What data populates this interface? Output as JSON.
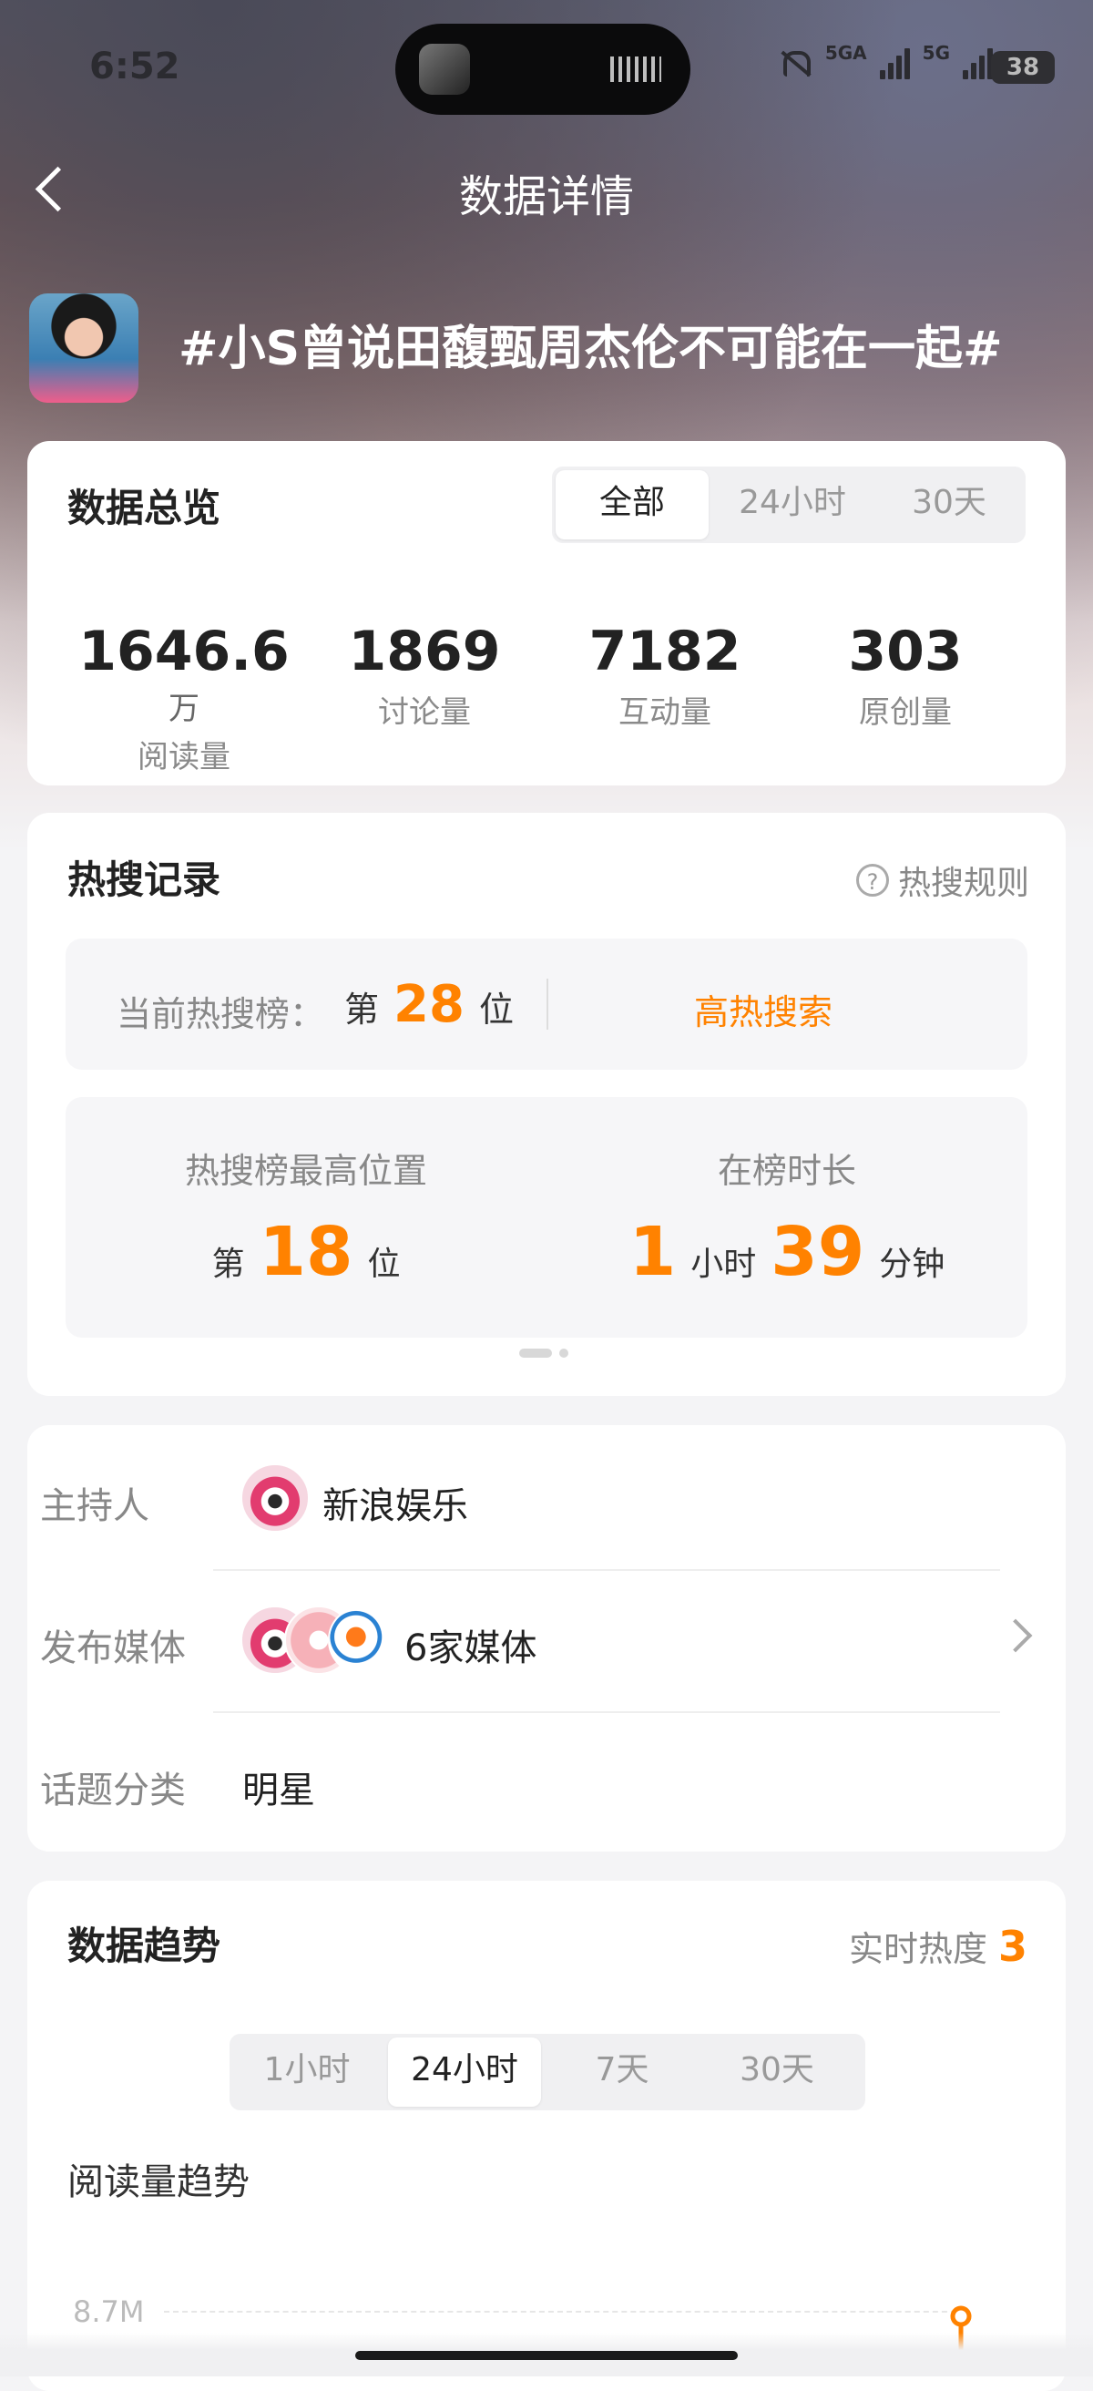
{
  "status_bar": {
    "time": "6:52",
    "net1": "5GA",
    "net2": "5G",
    "battery": "38"
  },
  "header": {
    "title": "数据详情"
  },
  "topic": {
    "title": "#小S曾说田馥甄周杰伦不可能在一起#"
  },
  "overview": {
    "title": "数据总览",
    "filters": [
      "全部",
      "24小时",
      "30天"
    ],
    "selected_filter": "全部",
    "stats": [
      {
        "value": "1646.6",
        "unit": "万",
        "label": "阅读量"
      },
      {
        "value": "1869",
        "unit": "",
        "label": "讨论量"
      },
      {
        "value": "7182",
        "unit": "",
        "label": "互动量"
      },
      {
        "value": "303",
        "unit": "",
        "label": "原创量"
      }
    ]
  },
  "hot_search": {
    "title": "热搜记录",
    "rules_label": "热搜规则",
    "current_label": "当前热搜榜：",
    "rank_prefix": "第",
    "current_rank": "28",
    "rank_suffix": "位",
    "hot_level": "高热搜索",
    "highest_label": "热搜榜最高位置",
    "highest_rank": "18",
    "duration_label": "在榜时长",
    "duration_hours": "1",
    "hours_unit": "小时",
    "duration_minutes": "39",
    "minutes_unit": "分钟"
  },
  "info": {
    "host_label": "主持人",
    "host_name": "新浪娱乐",
    "media_label": "发布媒体",
    "media_count": "6家媒体",
    "category_label": "话题分类",
    "category": "明星"
  },
  "trend": {
    "title": "数据趋势",
    "realtime_label": "实时热度",
    "realtime_value": "3",
    "filters": [
      "1小时",
      "24小时",
      "7天",
      "30天"
    ],
    "selected_filter": "24小时",
    "chart_title": "阅读量趋势",
    "y_tick": "8.7M"
  },
  "colors": {
    "accent": "#ff8200",
    "text": "#222222",
    "muted": "#888888"
  }
}
